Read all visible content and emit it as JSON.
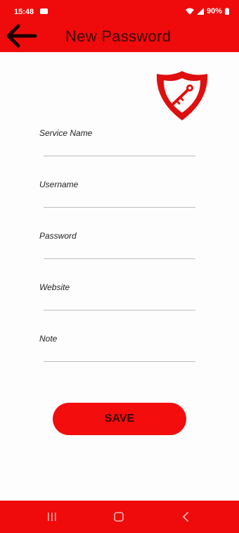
{
  "status_bar": {
    "time": "15:48",
    "battery": "90%"
  },
  "app_bar": {
    "title": "New Password",
    "back_icon": "arrow-left-icon",
    "logo_icon": "shield-key-icon"
  },
  "form": {
    "fields": [
      {
        "label": "Service Name",
        "value": ""
      },
      {
        "label": "Username",
        "value": ""
      },
      {
        "label": "Password",
        "value": ""
      },
      {
        "label": "Website",
        "value": ""
      },
      {
        "label": "Note",
        "value": ""
      }
    ],
    "save_label": "SAVE"
  },
  "nav_bar": {
    "icons": [
      "recent-apps-icon",
      "home-icon",
      "back-icon"
    ]
  },
  "colors": {
    "primary": "#ef0b0b",
    "title_text": "#3a0707",
    "background": "#fdfdfd"
  }
}
